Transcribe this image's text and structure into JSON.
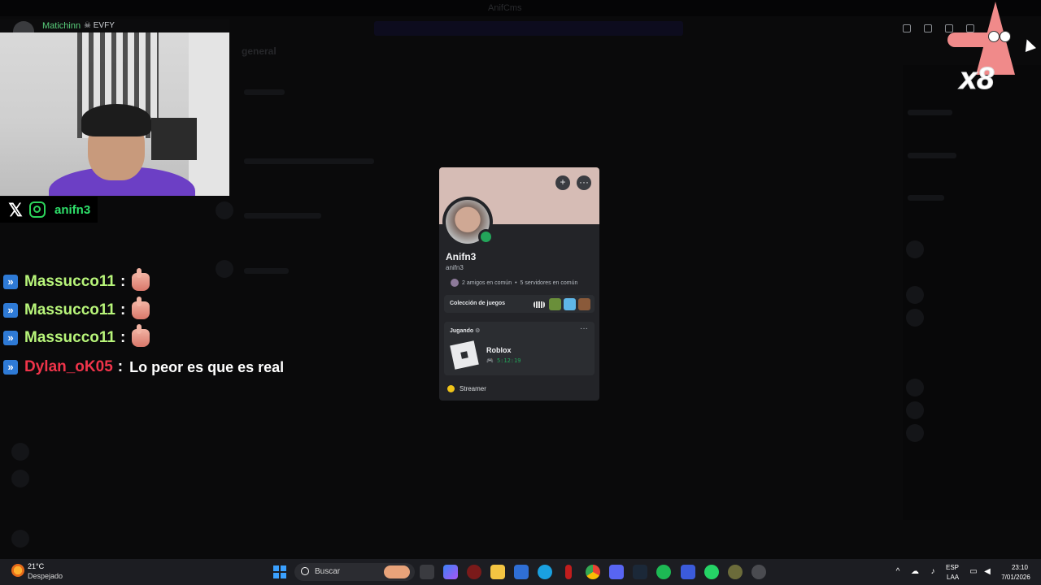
{
  "background_app": {
    "window_title": "AnifCms",
    "channel": "general"
  },
  "stream_overlay": {
    "cam_username": "Matichinn",
    "cam_badge": "EVFY",
    "social_handle": "anifn3",
    "chat": [
      {
        "user": "Massucco11",
        "user_color": "#b8f57a",
        "message": "",
        "emote": "hand-emote"
      },
      {
        "user": "Massucco11",
        "user_color": "#b8f57a",
        "message": "",
        "emote": "hand-emote"
      },
      {
        "user": "Massucco11",
        "user_color": "#b8f57a",
        "message": "",
        "emote": "hand-emote"
      },
      {
        "user": "Dylan_oK05",
        "user_color": "#f0344a",
        "message": "Lo peor es que es real",
        "emote": ""
      }
    ],
    "sticker_multiplier": "x8"
  },
  "profile": {
    "display_name": "Anifn3",
    "username": "anifn3",
    "mutual_friends": "2 amigos en común",
    "mutual_servers": "5 servidores en común",
    "games_label": "Colección de juegos",
    "activity_label": "Jugando",
    "game_name": "Roblox",
    "game_time": "5:12:19",
    "status": "Streamer",
    "banner_color": "#d6bcb5",
    "status_color": "#23a55a"
  },
  "taskbar": {
    "weather_temp": "21°C",
    "weather_desc": "Despejado",
    "search_placeholder": "Buscar",
    "lang_top": "ESP",
    "lang_bottom": "LAA",
    "time": "23:10",
    "date": "7/01/2026"
  }
}
